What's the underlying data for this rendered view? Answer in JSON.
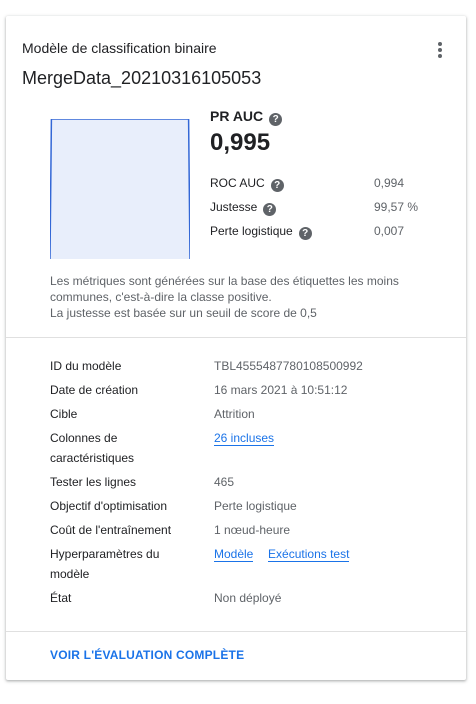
{
  "card": {
    "subtitle": "Modèle de classification binaire",
    "title": "MergeData_20210316105053",
    "more_icon": "more-vert-icon"
  },
  "chart_data": {
    "type": "area",
    "x": [
      0,
      0.01,
      0.99,
      1
    ],
    "y": [
      0.0,
      1.0,
      1.0,
      0.0
    ],
    "xlim": [
      0,
      1
    ],
    "ylim": [
      0,
      1
    ],
    "fill_color": "#e8eefb",
    "line_color": "#3367d6"
  },
  "metrics": {
    "primary_label": "PR AUC",
    "primary_value": "0,995",
    "rows": [
      {
        "label": "ROC AUC",
        "value": "0,994",
        "help": true
      },
      {
        "label": "Justesse",
        "value": "99,57 %",
        "help": true
      },
      {
        "label": "Perte logistique",
        "value": "0,007",
        "help": true
      }
    ],
    "help_icon": "help-circle-icon"
  },
  "note": {
    "line1": "Les métriques sont générées sur la base des étiquettes les moins communes, c'est-à-dire la classe positive.",
    "line2": "La justesse est basée sur un seuil de score de 0,5"
  },
  "details": [
    {
      "key": "ID du modèle",
      "value": "TBL4555487780108500992"
    },
    {
      "key": "Date de création",
      "value": "16 mars 2021 à 10:51:12"
    },
    {
      "key": "Cible",
      "value": "Attrition"
    },
    {
      "key": "Colonnes de caractéristiques",
      "value": "26 incluses",
      "link": true
    },
    {
      "key": "Tester les lignes",
      "value": "465"
    },
    {
      "key": "Objectif d'optimisation",
      "value": "Perte logistique"
    },
    {
      "key": "Coût de l'entraînement",
      "value": "1 nœud-heure"
    },
    {
      "key": "Hyperparamètres du modèle",
      "links": [
        "Modèle",
        "Exécutions test"
      ]
    },
    {
      "key": "État",
      "value": "Non déployé"
    }
  ],
  "footer": {
    "action_label": "VOIR L'ÉVALUATION COMPLÈTE"
  },
  "colors": {
    "accent": "#1a73e8",
    "chart_fill": "#e8eefb",
    "chart_line": "#3367d6"
  }
}
